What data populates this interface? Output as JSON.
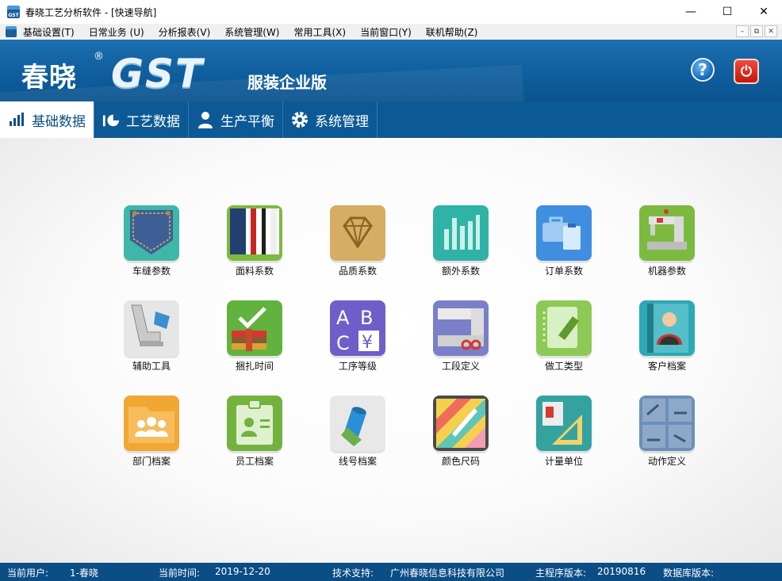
{
  "window": {
    "title": "春晓工艺分析软件 - [快速导航]",
    "app_icon": "gst-app-icon",
    "controls": {
      "minimize": "—",
      "maximize": "☐",
      "close": "✕"
    }
  },
  "menubar": {
    "items": [
      {
        "label": "基础设置(T)"
      },
      {
        "label": "日常业务 (U)"
      },
      {
        "label": "分析报表(V)"
      },
      {
        "label": "系统管理(W)"
      },
      {
        "label": "常用工具(X)"
      },
      {
        "label": "当前窗口(Y)"
      },
      {
        "label": "联机帮助(Z)"
      }
    ],
    "mdi_controls": {
      "minimize": "–",
      "restore": "⧉",
      "close": "✕"
    }
  },
  "banner": {
    "logo_cn": "春晓",
    "logo_reg": "®",
    "logo_gst": "GST",
    "edition": "服装企业版",
    "help_icon": "help-icon",
    "help_glyph": "?",
    "power_icon": "power-icon",
    "power_glyph": "⏻"
  },
  "tabs": [
    {
      "label": "基础数据",
      "icon": "bar-chart-icon",
      "active": true
    },
    {
      "label": "工艺数据",
      "icon": "pie-chart-icon",
      "active": false
    },
    {
      "label": "生产平衡",
      "icon": "person-icon",
      "active": false
    },
    {
      "label": "系统管理",
      "icon": "gear-icon",
      "active": false
    }
  ],
  "tiles": [
    {
      "label": "车缝参数",
      "icon": "denim-pocket-icon",
      "color": "#3fb6a8"
    },
    {
      "label": "面料系数",
      "icon": "fabric-stripes-icon",
      "color": "#7cba3f"
    },
    {
      "label": "品质系数",
      "icon": "diamond-icon",
      "color": "#d6ad62"
    },
    {
      "label": "额外系数",
      "icon": "bar-graph-icon",
      "color": "#2fb3a6"
    },
    {
      "label": "订单系数",
      "icon": "briefcase-clipboard-icon",
      "color": "#3f8ee0"
    },
    {
      "label": "机器参数",
      "icon": "sewing-machine-icon",
      "color": "#7cba3f"
    },
    {
      "label": "辅助工具",
      "icon": "presser-foot-icon",
      "color": "#e6e6e6"
    },
    {
      "label": "捆扎时间",
      "icon": "bundle-check-icon",
      "color": "#62b23f"
    },
    {
      "label": "工序等级",
      "icon": "abc-yen-icon",
      "color": "#6d5ec9"
    },
    {
      "label": "工段定义",
      "icon": "sewing-scissors-icon",
      "color": "#7a7fc9"
    },
    {
      "label": "做工类型",
      "icon": "notebook-pen-icon",
      "color": "#8cc955"
    },
    {
      "label": "客户档案",
      "icon": "contact-book-icon",
      "color": "#2da8b4"
    },
    {
      "label": "部门档案",
      "icon": "group-folder-icon",
      "color": "#f0a733"
    },
    {
      "label": "员工档案",
      "icon": "id-badge-icon",
      "color": "#73b23f"
    },
    {
      "label": "线号档案",
      "icon": "thread-spool-icon",
      "color": "#e8e8e8"
    },
    {
      "label": "颜色尺码",
      "icon": "color-palette-icon",
      "color": "#4a4a4a"
    },
    {
      "label": "计量单位",
      "icon": "ruler-triangle-icon",
      "color": "#34a3a0"
    },
    {
      "label": "动作定义",
      "icon": "motion-grid-icon",
      "color": "#6b8fb8"
    }
  ],
  "status": {
    "user_label": "当前用户:",
    "user_value": "1-春晓",
    "time_label": "当前时间:",
    "time_value": "2019-12-20",
    "support_label": "技术支持:",
    "support_value": "广州春晓信息科技有限公司",
    "version_label": "主程序版本:",
    "version_value": "20190816",
    "db_label": "数据库版本:",
    "db_value": ""
  }
}
